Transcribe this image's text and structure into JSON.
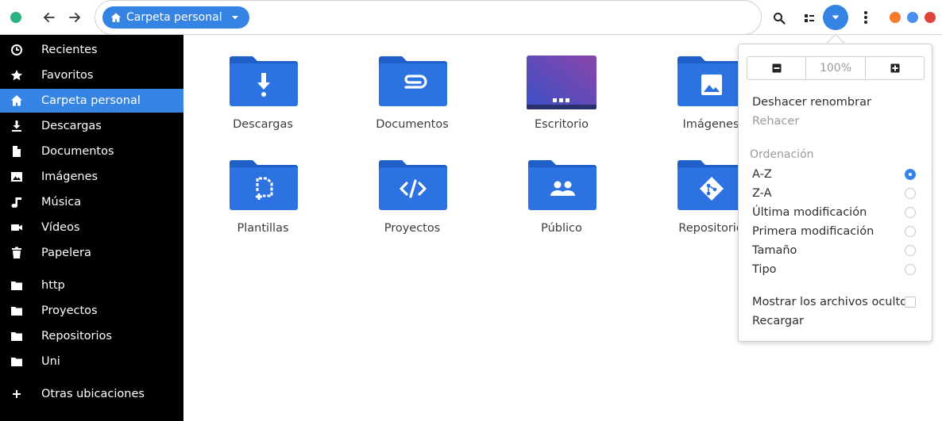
{
  "colors": {
    "accent": "#3584e4",
    "folder": "#2c72e0",
    "folder_dark": "#1f5fc8",
    "sidebar_bg": "#000000",
    "window_green": "#2bb37f",
    "window_orange": "#f77a2c",
    "window_blue": "#4a8ef0",
    "window_red": "#e0453b"
  },
  "header": {
    "back_icon": "arrow-left-icon",
    "forward_icon": "arrow-right-icon",
    "location": {
      "icon": "home-icon",
      "label": "Carpeta personal",
      "dropdown_icon": "caret-down-icon"
    },
    "search_icon": "search-icon",
    "view_icon": "grid-view-icon",
    "view_menu_icon": "caret-down-icon",
    "menu_icon": "kebab-menu-icon"
  },
  "sidebar": {
    "items": [
      {
        "icon": "clock-icon",
        "label": "Recientes"
      },
      {
        "icon": "star-icon",
        "label": "Favoritos"
      },
      {
        "icon": "home-icon",
        "label": "Carpeta personal",
        "active": true
      },
      {
        "icon": "download-icon",
        "label": "Descargas"
      },
      {
        "icon": "document-icon",
        "label": "Documentos"
      },
      {
        "icon": "image-icon",
        "label": "Imágenes"
      },
      {
        "icon": "music-icon",
        "label": "Música"
      },
      {
        "icon": "video-icon",
        "label": "Vídeos"
      },
      {
        "icon": "trash-icon",
        "label": "Papelera"
      },
      {
        "icon": "folder-icon",
        "label": "http"
      },
      {
        "icon": "folder-icon",
        "label": "Proyectos"
      },
      {
        "icon": "folder-icon",
        "label": "Repositorios"
      },
      {
        "icon": "folder-icon",
        "label": "Uni"
      },
      {
        "icon": "plus-icon",
        "label": "Otras ubicaciones"
      }
    ]
  },
  "files": [
    {
      "name": "Descargas",
      "icon": "download-folder-icon"
    },
    {
      "name": "Documentos",
      "icon": "documents-folder-icon"
    },
    {
      "name": "Escritorio",
      "icon": "desktop-folder-icon"
    },
    {
      "name": "Imágenes",
      "icon": "pictures-folder-icon"
    },
    {
      "name": "Plantillas",
      "icon": "templates-folder-icon"
    },
    {
      "name": "Proyectos",
      "icon": "code-folder-icon"
    },
    {
      "name": "Público",
      "icon": "public-folder-icon"
    },
    {
      "name": "Repositorio",
      "icon": "git-folder-icon"
    }
  ],
  "popover": {
    "zoom_out_icon": "minus-icon",
    "zoom_level": "100%",
    "zoom_in_icon": "plus-icon",
    "undo": "Deshacer renombrar",
    "redo": "Rehacer",
    "sort_heading": "Ordenación",
    "sort_options": [
      {
        "label": "A-Z",
        "selected": true
      },
      {
        "label": "Z-A",
        "selected": false
      },
      {
        "label": "Última modificación",
        "selected": false
      },
      {
        "label": "Primera modificación",
        "selected": false
      },
      {
        "label": "Tamaño",
        "selected": false
      },
      {
        "label": "Tipo",
        "selected": false
      }
    ],
    "show_hidden": {
      "label": "Mostrar los archivos ocultos",
      "checked": false
    },
    "reload": "Recargar"
  }
}
